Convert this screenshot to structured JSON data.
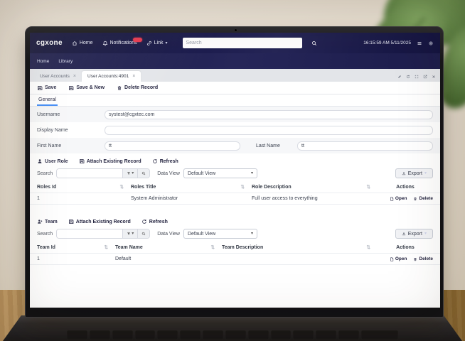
{
  "navbar": {
    "logo": "cgxone",
    "home": "Home",
    "notifications": "Notifications",
    "link": "Link",
    "search_placeholder": "Search",
    "clock": "16:15:59 AM 5/11/2025"
  },
  "menubar": {
    "items": [
      "Home",
      "Library"
    ]
  },
  "tabs": {
    "tab1": "User Accounts",
    "tab2": "User Accounts:4901"
  },
  "record_toolbar": {
    "save": "Save",
    "save_new": "Save & New",
    "delete": "Delete Record"
  },
  "form": {
    "general_tab": "General",
    "username_label": "Username",
    "username_value": "systest@cgxtec.com",
    "display_name_label": "Display Name",
    "display_name_value": "",
    "first_name_label": "First Name",
    "first_name_value": "tt",
    "last_name_label": "Last Name",
    "last_name_value": "tt"
  },
  "roles": {
    "add_button": "User Role",
    "attach_button": "Attach Existing Record",
    "refresh_button": "Refresh",
    "search_label": "Search",
    "data_view_label": "Data View",
    "data_view_value": "Default View",
    "export_button": "Export",
    "headers": {
      "id": "Roles Id",
      "title": "Roles Title",
      "description": "Role Description",
      "actions": "Actions"
    },
    "row": {
      "id": "1",
      "title": "System Administrator",
      "description": "Full user access to everything"
    },
    "open_action": "Open",
    "delete_action": "Delete"
  },
  "teams": {
    "add_button": "Team",
    "attach_button": "Attach Existing Record",
    "refresh_button": "Refresh",
    "search_label": "Search",
    "data_view_label": "Data View",
    "data_view_value": "Default View",
    "export_button": "Export",
    "headers": {
      "id": "Team Id",
      "name": "Team Name",
      "description": "Team Description",
      "actions": "Actions"
    },
    "row": {
      "id": "1",
      "name": "Default",
      "description": ""
    },
    "open_action": "Open",
    "delete_action": "Delete"
  },
  "icons": {
    "sort": "⇅",
    "caret_down": "▾",
    "close": "×"
  },
  "colors": {
    "accent_blue": "#3d8af7",
    "badge_red": "#e8384f",
    "navbar_bg": "#14143c"
  }
}
